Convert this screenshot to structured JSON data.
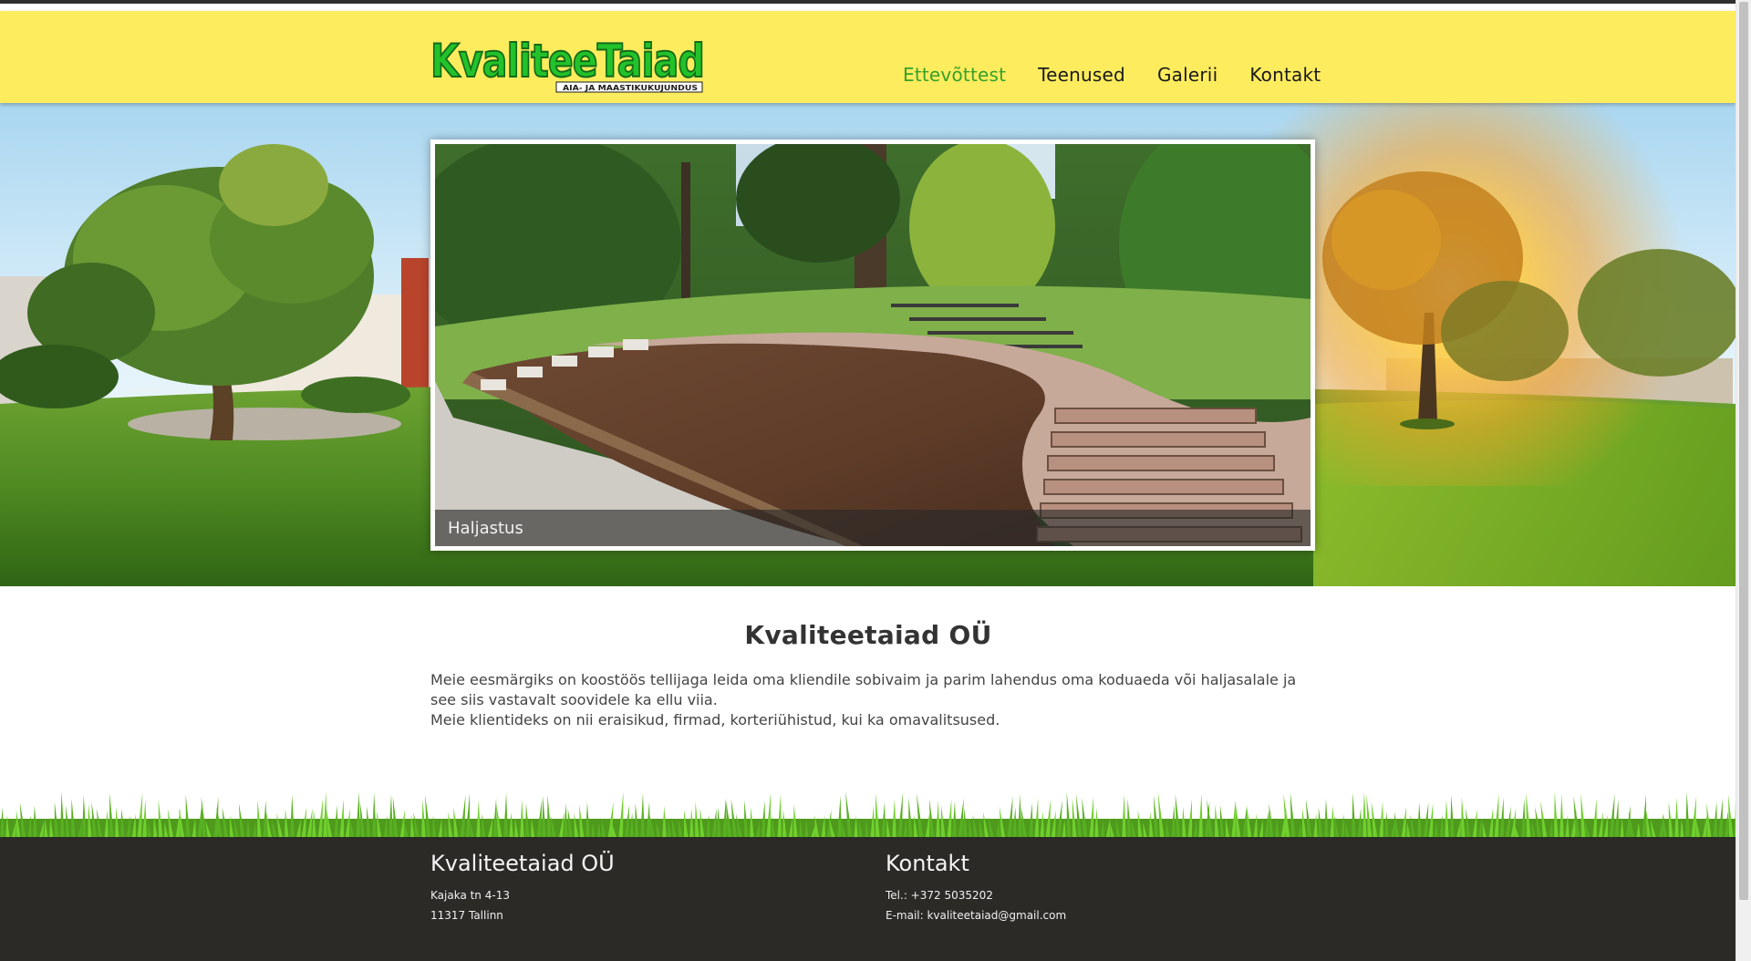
{
  "site": {
    "logo_text": "KvaliteeTaiad",
    "logo_tagline": "AIA- JA MAASTIKUKUJUNDUS"
  },
  "nav": {
    "items": [
      {
        "label": "Ettevõttest",
        "active": true
      },
      {
        "label": "Teenused",
        "active": false
      },
      {
        "label": "Galerii",
        "active": false
      },
      {
        "label": "Kontakt",
        "active": false
      }
    ]
  },
  "slider": {
    "caption": "Haljastus"
  },
  "content": {
    "title": "Kvaliteetaiad OÜ",
    "paragraph1": "Meie eesmärgiks on koostöös tellijaga leida oma kliendile sobivaim ja parim lahendus oma koduaeda või haljasalale ja see siis vastavalt soovidele ka ellu viia.",
    "paragraph2": "Meie klientideks on nii eraisikud, firmad, korteriühistud, kui ka omavalitsused."
  },
  "footer": {
    "company": {
      "title": "Kvaliteetaiad OÜ",
      "address_line1": "Kajaka tn 4-13",
      "address_line2": "11317 Tallinn"
    },
    "contact": {
      "title": "Kontakt",
      "phone": "Tel.: +372 5035202",
      "email": "E-mail: kvaliteetaiad@gmail.com"
    }
  },
  "colors": {
    "header_bg": "#fdec5e",
    "nav_active": "#35a12a",
    "logo_green": "#22c22a",
    "footer_bg": "#2b2a27"
  }
}
